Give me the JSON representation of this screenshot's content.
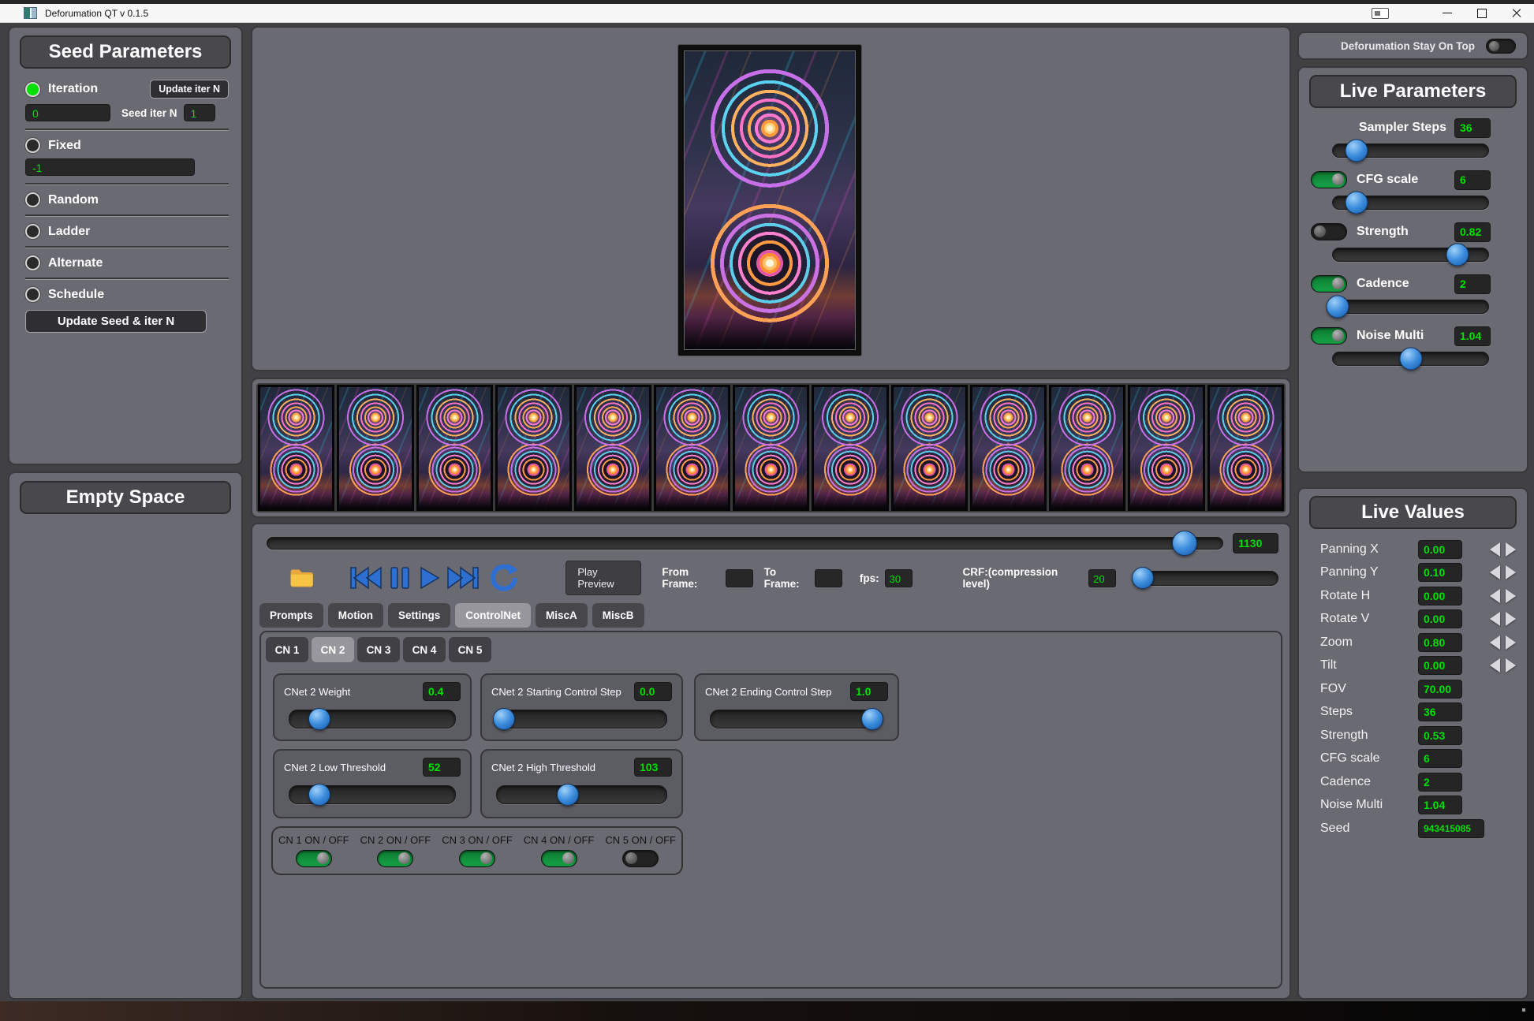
{
  "titlebar": {
    "title": "Deforumation QT v 0.1.5"
  },
  "colors": {
    "value_green": "#00e000",
    "slider_blue": "#3e8ede",
    "toggle_on_green": "#17a347",
    "panel_gray": "#6a6a72"
  },
  "icons": [
    "app-icon",
    "input-panel-icon",
    "minimize-icon",
    "maximize-icon",
    "close-icon",
    "folder-icon",
    "skip-start-icon",
    "pause-icon",
    "play-icon",
    "skip-end-icon",
    "repeat-icon",
    "decrement-arrow",
    "increment-arrow"
  ],
  "seed_parameters": {
    "title": "Seed Parameters",
    "selected_option": "Iteration",
    "iteration_label": "Iteration",
    "update_iter_button": "Update iter N",
    "iteration_value": "0",
    "seed_iter_label": "Seed iter N",
    "seed_iter_value": "1",
    "fixed_label": "Fixed",
    "fixed_value": "-1",
    "random_label": "Random",
    "ladder_label": "Ladder",
    "alternate_label": "Alternate",
    "schedule_label": "Schedule",
    "update_seed_button": "Update Seed & iter N"
  },
  "empty_space": {
    "title": "Empty Space"
  },
  "filmstrip": {
    "frame_count": 13
  },
  "timeline": {
    "value": "1130",
    "slider_pct": 96
  },
  "playback": {
    "play_preview_button": "Play Preview",
    "from_frame_label": "From Frame:",
    "from_frame_value": "",
    "to_frame_label": "To Frame:",
    "to_frame_value": "",
    "fps_label": "fps:",
    "fps_value": "30",
    "crf_label": "CRF:(compression level)",
    "crf_value": "20",
    "crf_slider_pct": 4
  },
  "main_tabs": {
    "active": "ControlNet",
    "items": [
      {
        "label": "Prompts"
      },
      {
        "label": "Motion"
      },
      {
        "label": "Settings"
      },
      {
        "label": "ControlNet"
      },
      {
        "label": "MiscA"
      },
      {
        "label": "MiscB"
      }
    ]
  },
  "cn_tabs": {
    "active": "CN 2",
    "items": [
      {
        "label": "CN 1"
      },
      {
        "label": "CN 2"
      },
      {
        "label": "CN 3"
      },
      {
        "label": "CN 4"
      },
      {
        "label": "CN 5"
      }
    ]
  },
  "cn_controls": [
    {
      "label": "CNet 2 Weight",
      "value": "0.4",
      "slider_pct": 18
    },
    {
      "label": "CNet 2 Starting Control Step",
      "value": "0.0",
      "slider_pct": 4
    },
    {
      "label": "CNet 2 Ending Control Step",
      "value": "1.0",
      "slider_pct": 94
    },
    {
      "label": "CNet 2 Low Threshold",
      "value": "52",
      "slider_pct": 18
    },
    {
      "label": "CNet 2 High Threshold",
      "value": "103",
      "slider_pct": 42
    }
  ],
  "cn_switches": [
    {
      "label": "CN 1 ON / OFF",
      "on": true
    },
    {
      "label": "CN 2 ON / OFF",
      "on": true
    },
    {
      "label": "CN 3 ON / OFF",
      "on": true
    },
    {
      "label": "CN 4 ON / OFF",
      "on": true
    },
    {
      "label": "CN 5 ON / OFF",
      "on": false
    }
  ],
  "stay_on_top": {
    "label": "Deforumation Stay On Top",
    "on": false
  },
  "live_parameters": {
    "title": "Live Parameters",
    "params": [
      {
        "label": "Sampler Steps",
        "value": "36",
        "toggle": "none",
        "slider_pct": 15
      },
      {
        "label": "CFG scale",
        "value": "6",
        "toggle": "on",
        "slider_pct": 15
      },
      {
        "label": "Strength",
        "value": "0.82",
        "toggle": "off",
        "slider_pct": 80
      },
      {
        "label": "Cadence",
        "value": "2",
        "toggle": "on",
        "slider_pct": 3
      },
      {
        "label": "Noise Multi",
        "value": "1.04",
        "toggle": "on",
        "slider_pct": 50
      }
    ]
  },
  "live_values": {
    "title": "Live Values",
    "rows": [
      {
        "label": "Panning X",
        "value": "0.00",
        "arrows": true
      },
      {
        "label": "Panning Y",
        "value": "0.10",
        "arrows": true
      },
      {
        "label": "Rotate H",
        "value": "0.00",
        "arrows": true
      },
      {
        "label": "Rotate V",
        "value": "0.00",
        "arrows": true
      },
      {
        "label": "Zoom",
        "value": "0.80",
        "arrows": true
      },
      {
        "label": "Tilt",
        "value": "0.00",
        "arrows": true
      },
      {
        "label": "FOV",
        "value": "70.00",
        "arrows": false
      },
      {
        "label": "Steps",
        "value": "36",
        "arrows": false
      },
      {
        "label": "Strength",
        "value": "0.53",
        "arrows": false
      },
      {
        "label": "CFG scale",
        "value": "6",
        "arrows": false
      },
      {
        "label": "Cadence",
        "value": "2",
        "arrows": false
      },
      {
        "label": "Noise Multi",
        "value": "1.04",
        "arrows": false
      },
      {
        "label": "Seed",
        "value": "943415085",
        "arrows": false
      }
    ]
  }
}
